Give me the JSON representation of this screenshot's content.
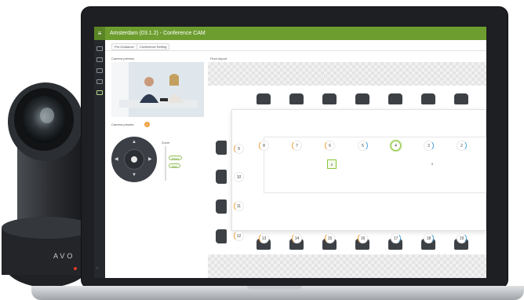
{
  "app": {
    "logo_glyph": "≡",
    "title": "Amsterdam (03.1.2) - Conference CAM",
    "subtabs": [
      "Pre-Guidance",
      "Conference Setting"
    ]
  },
  "left": {
    "preview_label": "Camera preview",
    "preset_label": "Camera presets",
    "zoom_label": "Zoom",
    "preset_value": "2",
    "buttons": [
      "Preset",
      "Save"
    ]
  },
  "floor": {
    "label": "Floor layout",
    "search_glyph": "⌕"
  },
  "seats": {
    "top": [
      "8",
      "7",
      "6",
      "5",
      "4",
      "3",
      "2"
    ],
    "bottom": [
      "13",
      "14",
      "15",
      "16",
      "17",
      "18",
      "19"
    ],
    "left": [
      "9",
      "10",
      "11",
      "12"
    ]
  },
  "cameras": {
    "cam1": "1",
    "cam2": "2"
  },
  "brand": "AVO",
  "colors": {
    "accent": "#6d9d2e",
    "orange": "#f0a040",
    "blue": "#4aa3d8"
  }
}
